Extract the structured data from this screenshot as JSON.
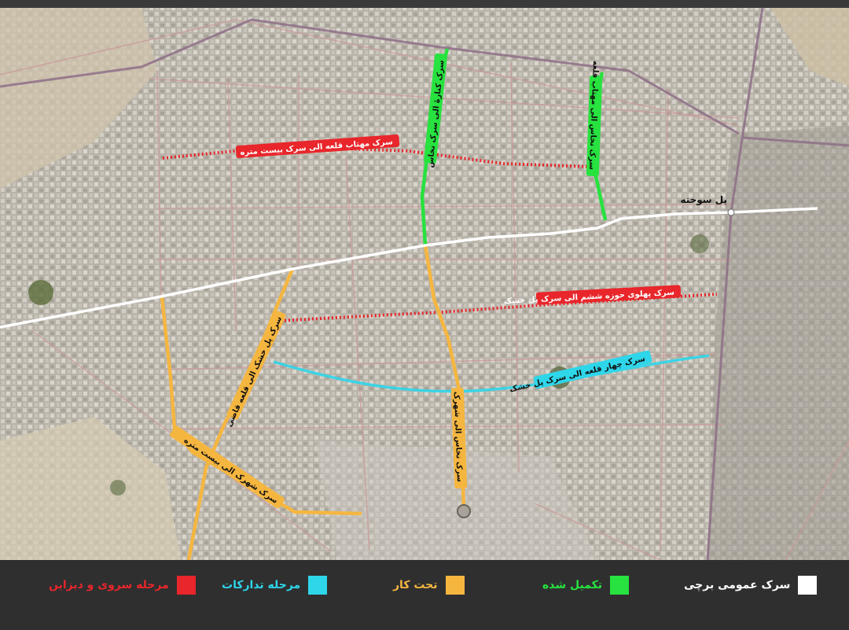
{
  "colors": {
    "survey_design": "#e8262b",
    "procurement": "#2ed6ea",
    "under_construction": "#f5b640",
    "completed": "#27e23f",
    "public_road": "#ffffff"
  },
  "map": {
    "place_label": "پل سوخته",
    "roads": [
      {
        "key": "r1",
        "label": "سرک مهتاب قلعه الی سرک بیست متره",
        "status": "survey_design"
      },
      {
        "key": "r2",
        "label": "سرک پهلوی حوزه ششم الی سرک پل خشک",
        "status": "survey_design"
      },
      {
        "key": "r3",
        "label": "سرک چهار قلعه الی سرک پل خشک",
        "status": "procurement"
      },
      {
        "key": "r4",
        "label": "سرک پل خشک الی قلعه قاضی",
        "status": "under_construction"
      },
      {
        "key": "r5",
        "label": "سرک شهرک الی بیست متره",
        "status": "under_construction"
      },
      {
        "key": "r6",
        "label": "سرک نخاس الی شهرک",
        "status": "under_construction"
      },
      {
        "key": "r7",
        "label": "سرک کنارهٔ الی سرک نخاس",
        "status": "completed"
      },
      {
        "key": "r8",
        "label": "سرک نخاس الی مهتاب قلعه",
        "status": "completed"
      }
    ]
  },
  "legend": [
    {
      "label": "سرک عمومی برچی",
      "color": "#ffffff"
    },
    {
      "label": "تکمیل شده",
      "color": "#27e23f"
    },
    {
      "label": "تحت کار",
      "color": "#f5b640"
    },
    {
      "label": "مرحله تدارکات",
      "color": "#2ed6ea"
    },
    {
      "label": "مرحله سروی و دیزاین",
      "color": "#e8262b"
    }
  ]
}
